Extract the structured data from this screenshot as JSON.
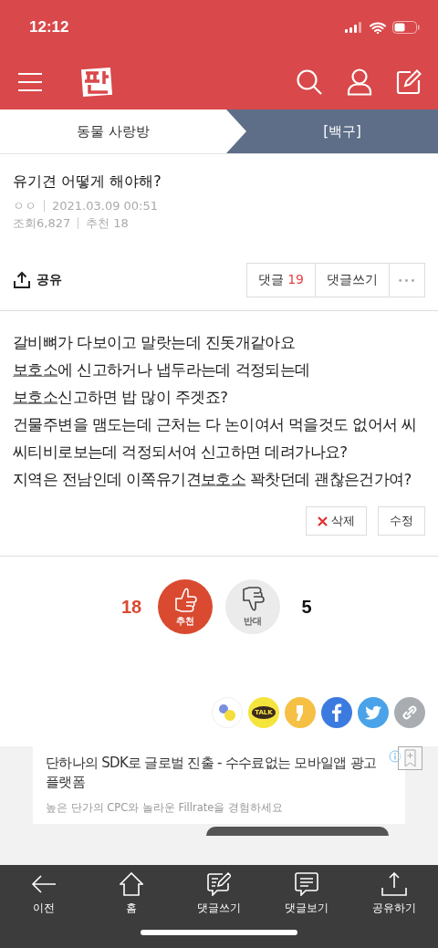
{
  "status_bar": {
    "time": "12:12"
  },
  "breadcrumb": [
    {
      "label": "동물 사랑방",
      "selected": false
    },
    {
      "label": "[백구]",
      "selected": true
    }
  ],
  "post": {
    "title": "유기견 어떻게 해야해?",
    "author": "ㅇㅇ",
    "date": "2021.03.09 00:51",
    "views_label": "조회",
    "views": "6,827",
    "recommend_label": "추천",
    "recommend": "18"
  },
  "actions": {
    "share": "공유",
    "comments_label": "댓글",
    "comments_count": "19",
    "write_comment": "댓글쓰기",
    "more": "•••"
  },
  "body": [
    [
      {
        "text": "갈비뼈가 다보이고 말랏는데 진돗개같아요",
        "link": false
      }
    ],
    [
      {
        "text": "보호소",
        "link": true
      },
      {
        "text": "에 신고하거나 냅두라는데 걱정되는데",
        "link": false
      }
    ],
    [
      {
        "text": "보호소",
        "link": true
      },
      {
        "text": "신고하면 밥 많이 주겟죠?",
        "link": false
      }
    ],
    [
      {
        "text": "건물주변을 맴도는데 근처는 다 논이여서 먹을것도 없어서 씨",
        "link": false
      }
    ],
    [
      {
        "text": "씨티비로보는데 걱정되서여 신고하면 데려가나요?",
        "link": false
      }
    ],
    [
      {
        "text": "지역은 전남인데 이쪽유기견",
        "link": false
      },
      {
        "text": "보호소",
        "link": true
      },
      {
        "text": " 꽉찻던데 괜찮은건가여?",
        "link": false
      }
    ]
  ],
  "edit_buttons": {
    "delete": "삭제",
    "edit": "수정"
  },
  "votes": [
    {
      "kind": "up",
      "count": "18",
      "label": "추천",
      "selected": true
    },
    {
      "kind": "down",
      "count": "5",
      "label": "반대",
      "selected": false
    }
  ],
  "share_icons": [
    {
      "kind": "band"
    },
    {
      "kind": "kakaotalk",
      "label": "TALK"
    },
    {
      "kind": "kakaostory"
    },
    {
      "kind": "facebook"
    },
    {
      "kind": "twitter"
    },
    {
      "kind": "link"
    }
  ],
  "ad": {
    "title": "단하나의 SDK로 글로벌 진출 - 수수료없는 모바일앱 광고 플랫폼",
    "subtitle": "높은 단가의 CPC와 놀라운 Fillrate을 경험하세요"
  },
  "bottom_nav": [
    {
      "kind": "back",
      "label": "이전"
    },
    {
      "kind": "home",
      "label": "홈"
    },
    {
      "kind": "write",
      "label": "댓글쓰기"
    },
    {
      "kind": "comments",
      "label": "댓글보기"
    },
    {
      "kind": "share",
      "label": "공유하기"
    }
  ]
}
